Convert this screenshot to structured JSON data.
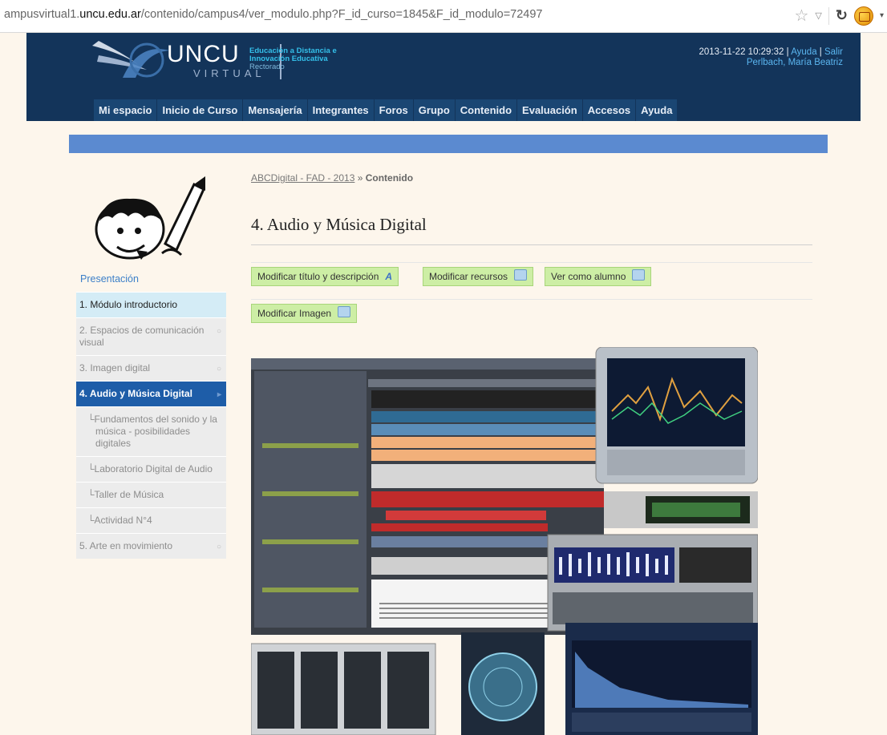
{
  "browser": {
    "url_prefix": "ampusvirtual1.",
    "url_domain": "uncu.edu.ar",
    "url_path": "/contenido/campus4/ver_modulo.php?F_id_curso=1845&F_id_modulo=72497"
  },
  "header": {
    "logo_text": "UNCU",
    "logo_sub": "VIRTUAL",
    "tagline1": "Educación a Distancia e",
    "tagline2": "Innovación Educativa",
    "tagline3": "Rectorado",
    "datetime": "2013-11-22 10:29:32",
    "sep1": " | ",
    "help": "Ayuda",
    "sep2": " | ",
    "logout": "Salir",
    "user": "Perlbach, María Beatriz"
  },
  "nav": [
    "Mi espacio",
    "Inicio de Curso",
    "Mensajería",
    "Integrantes",
    "Foros",
    "Grupo",
    "Contenido",
    "Evaluación",
    "Accesos",
    "Ayuda"
  ],
  "sidebar": {
    "title": "Presentación",
    "items": [
      {
        "label": "1. Módulo introductorio"
      },
      {
        "label": "2. Espacios de comunicación visual"
      },
      {
        "label": "3. Imagen digital"
      },
      {
        "label": "4. Audio y Música Digital"
      },
      {
        "label": "Fundamentos del sonido y la música - posibilidades digitales"
      },
      {
        "label": "Laboratorio Digital de Audio"
      },
      {
        "label": "Taller de Música"
      },
      {
        "label": "Actividad N°4"
      },
      {
        "label": "5. Arte en movimiento"
      }
    ]
  },
  "breadcrumb": {
    "course": "ABCDigital - FAD - 2013",
    "sep": " » ",
    "current": "Contenido"
  },
  "page_title": "4. Audio y Música Digital",
  "buttons": {
    "edit_title": "Modificar título y descripción",
    "edit_resources": "Modificar recursos",
    "view_student": "Ver como alumno",
    "edit_image": "Modificar Imagen"
  },
  "colors": {
    "header_bg": "#13345a",
    "nav_bg": "#1a4673",
    "bar_blue": "#5b8ad0",
    "active_item": "#1e5da8",
    "button_green": "#cdeea5"
  }
}
